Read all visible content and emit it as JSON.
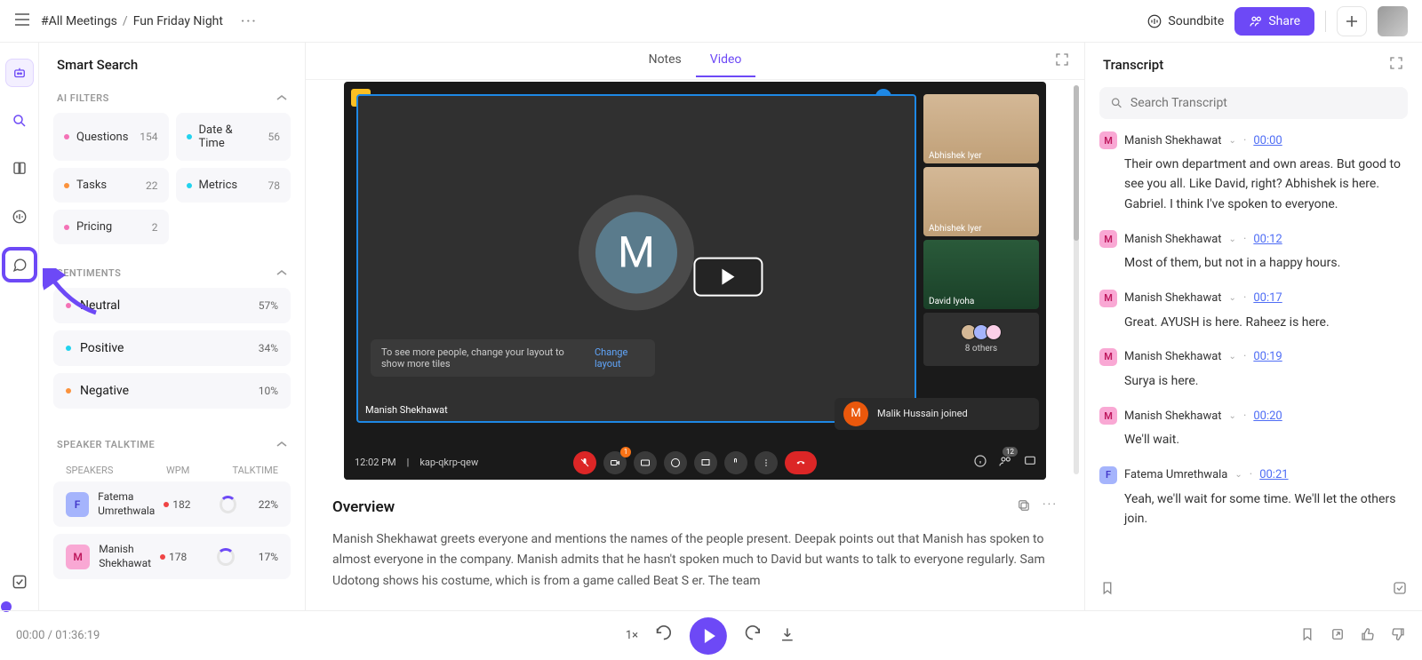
{
  "breadcrumb": {
    "root": "#All Meetings",
    "page": "Fun Friday Night"
  },
  "topbar": {
    "soundbite": "Soundbite",
    "share": "Share"
  },
  "sidebar": {
    "title": "Smart Search",
    "filters_hdr": "AI FILTERS",
    "filters": {
      "questions": {
        "label": "Questions",
        "count": "154"
      },
      "datetime": {
        "label": "Date & Time",
        "count": "56"
      },
      "tasks": {
        "label": "Tasks",
        "count": "22"
      },
      "metrics": {
        "label": "Metrics",
        "count": "78"
      },
      "pricing": {
        "label": "Pricing",
        "count": "2"
      }
    },
    "sent_hdr": "SENTIMENTS",
    "sentiments": {
      "neutral": {
        "label": "Neutral",
        "pct": "57%"
      },
      "positive": {
        "label": "Positive",
        "pct": "34%"
      },
      "negative": {
        "label": "Negative",
        "pct": "10%"
      }
    },
    "talk_hdr": "SPEAKER TALKTIME",
    "cols": {
      "spk": "SPEAKERS",
      "wpm": "WPM",
      "tt": "TALKTIME"
    },
    "speakers": {
      "s1": {
        "initial": "F",
        "name": "Fatema Umrethwala",
        "wpm": "182",
        "tt": "22%"
      },
      "s2": {
        "initial": "M",
        "name": "Manish Shekhawat",
        "wpm": "178",
        "tt": "17%"
      }
    }
  },
  "tabs": {
    "notes": "Notes",
    "video": "Video"
  },
  "video": {
    "main_initial": "M",
    "main_name": "Manish Shekhawat",
    "tip": "To see more people, change your layout to show more tiles",
    "tip_link": "Change layout",
    "tile1": "Abhishek Iyer",
    "tile2": "Abhishek Iyer",
    "tile3": "David Iyoha",
    "others": "8 others",
    "joined_initial": "M",
    "joined": "Malik Hussain joined",
    "clock": "12:02 PM",
    "code": "kap-qkrp-qew",
    "badge": "1",
    "people_badge": "12"
  },
  "overview": {
    "title": "Overview",
    "body": "Manish Shekhawat greets everyone and mentions the names of the people present. Deepak points out that Manish has spoken to almost everyone in the company. Manish admits that he hasn't spoken much to David but wants to talk to everyone regularly. Sam Udotong shows his costume, which is from a game called Beat S    er. The team"
  },
  "transcript": {
    "title": "Transcript",
    "search_ph": "Search Transcript",
    "items": [
      {
        "av": "M",
        "cls": "trM",
        "name": "Manish Shekhawat",
        "time": "00:00",
        "text": "Their own department and own areas. But good to see you all. Like David, right? Abhishek is here. Gabriel. I think I've spoken to everyone."
      },
      {
        "av": "M",
        "cls": "trM",
        "name": "Manish Shekhawat",
        "time": "00:12",
        "text": "Most of them, but not in a happy hours."
      },
      {
        "av": "M",
        "cls": "trM",
        "name": "Manish Shekhawat",
        "time": "00:17",
        "text": "Great. AYUSH is here. Raheez is here."
      },
      {
        "av": "M",
        "cls": "trM",
        "name": "Manish Shekhawat",
        "time": "00:19",
        "text": "Surya is here."
      },
      {
        "av": "M",
        "cls": "trM",
        "name": "Manish Shekhawat",
        "time": "00:20",
        "text": "We'll wait."
      },
      {
        "av": "F",
        "cls": "trF",
        "name": "Fatema Umrethwala",
        "time": "00:21",
        "text": "Yeah, we'll wait for some time. We'll let the others join."
      }
    ]
  },
  "playbar": {
    "cur": "00:00",
    "total": "01:36:19",
    "speed": "1×"
  }
}
